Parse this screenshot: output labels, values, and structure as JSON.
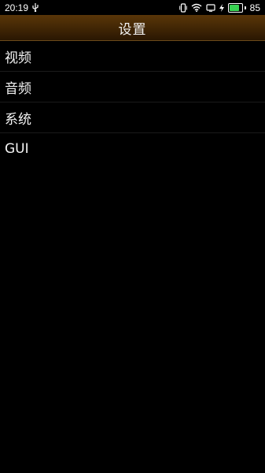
{
  "status_bar": {
    "time": "20:19",
    "usb_icon": "usb-icon",
    "vibrate_icon": "vibrate-icon",
    "wifi_icon": "wifi-icon",
    "screen_icon": "screen-icon",
    "charging_icon": "charging-bolt-icon",
    "battery_level": 85,
    "battery_text": "85",
    "battery_color": "#39d353"
  },
  "header": {
    "title": "设置",
    "gradient_top": "#5a3608",
    "gradient_bottom": "#2a1702"
  },
  "menu": {
    "items": [
      {
        "label": "视频"
      },
      {
        "label": "音频"
      },
      {
        "label": "系统"
      },
      {
        "label": "GUI"
      }
    ]
  }
}
